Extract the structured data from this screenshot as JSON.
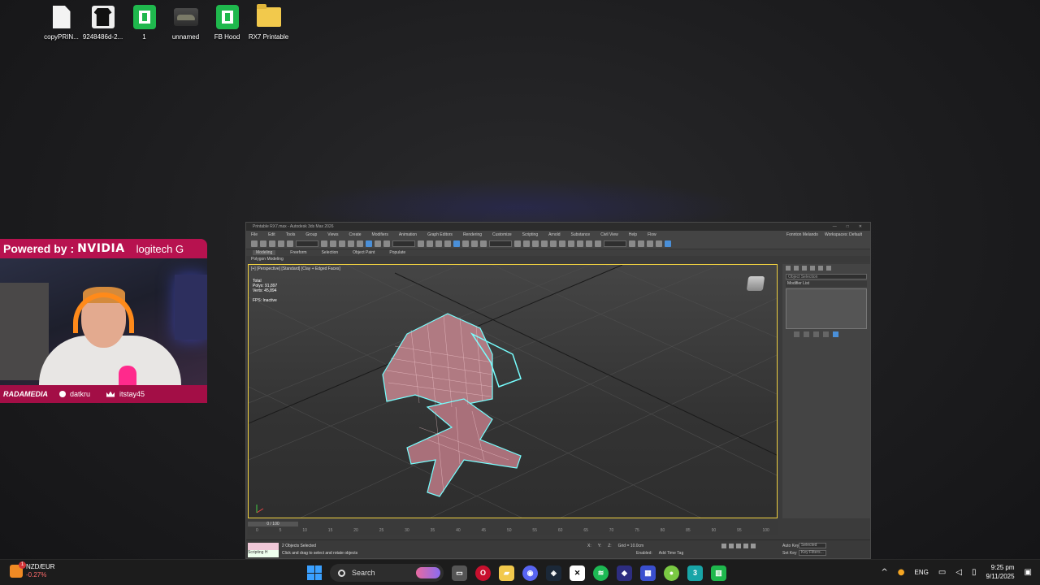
{
  "desktop": {
    "icons": [
      {
        "label": "copyPRIN...",
        "icon": "file-icon"
      },
      {
        "label": "9248486d-2...",
        "icon": "tshirt-image-icon"
      },
      {
        "label": "1",
        "icon": "green-app-icon"
      },
      {
        "label": "unnamed",
        "icon": "car-image-icon"
      },
      {
        "label": "FB Hood",
        "icon": "green-app-icon"
      },
      {
        "label": "RX7 Printable",
        "icon": "folder-icon"
      }
    ]
  },
  "webcam": {
    "powered_by": "Powered by :",
    "nvidia": "NVIDIA",
    "logitech": "logitech G",
    "brand": "RADAMEDIA",
    "user1": "datkru",
    "user2": "itstay45"
  },
  "max": {
    "title": "Printable RX7.max - Autodesk 3ds Max 2026",
    "menu": [
      "File",
      "Edit",
      "Tools",
      "Group",
      "Views",
      "Create",
      "Modifiers",
      "Animation",
      "Graph Editors",
      "Rendering",
      "Customize",
      "Scripting",
      "Arnold",
      "Substance",
      "Civil View",
      "Help",
      "Flow"
    ],
    "user": "Fonnton Melando",
    "workspaces": "Workspaces: Default",
    "ribbon": [
      "Modeling",
      "Freeform",
      "Selection",
      "Object Paint",
      "Populate"
    ],
    "ribbon_sub": "Polygon Modeling",
    "viewport_label": "[+] [Perspective] [Standard] [Clay + Edged Faces]",
    "stats_total": "Total",
    "stats_polys": "Polys: 91,897",
    "stats_verts": "Verts: 45,894",
    "fps": "FPS:   Inactive",
    "cmd_search": "Object Selection",
    "modifier_list": "Modifier List",
    "time_slider": "0 / 100",
    "ticks": [
      "0",
      "5",
      "10",
      "15",
      "20",
      "25",
      "30",
      "35",
      "40",
      "45",
      "50",
      "55",
      "60",
      "65",
      "70",
      "75",
      "80",
      "85",
      "90",
      "95",
      "100"
    ],
    "maxscript": "Scripting H",
    "status1": "2 Objects Selected",
    "status2": "Click and drag to select and rotate objects",
    "coord_x": "X:",
    "coord_y": "Y:",
    "coord_z": "Z:",
    "grid": "Grid = 10.0cm",
    "enabled": "Enabled:",
    "add_time_tag": "Add Time Tag",
    "auto_key": "Auto Key",
    "set_key": "Set Key",
    "selected": "Selected",
    "key_filters": "Key Filters..."
  },
  "taskbar": {
    "widget_title": "NZD/EUR",
    "widget_value": "-0.27%",
    "search": "Search",
    "lang": "ENG",
    "time": "9:25 pm",
    "date": "9/11/2025"
  }
}
